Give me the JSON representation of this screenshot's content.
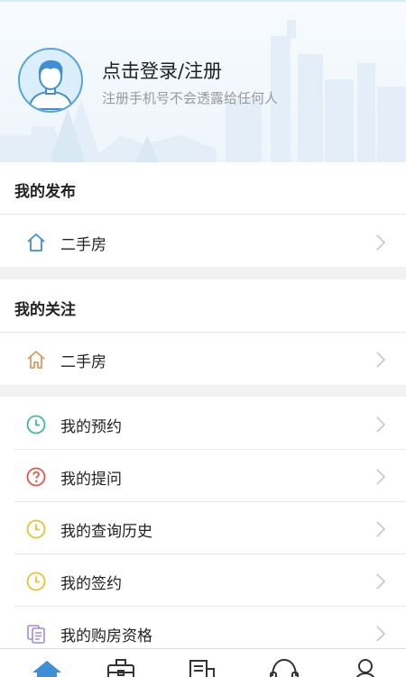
{
  "header": {
    "login_title": "点击登录/注册",
    "login_subtitle": "注册手机号不会透露给任何人",
    "avatar_icon": "user-avatar-icon"
  },
  "my_posts": {
    "title": "我的发布",
    "items": [
      {
        "label": "二手房",
        "icon": "house-outline-icon",
        "color": "#3d8fd6"
      }
    ]
  },
  "my_follows": {
    "title": "我的关注",
    "items": [
      {
        "label": "二手房",
        "icon": "house-outline-icon",
        "color": "#e19a5b"
      }
    ]
  },
  "menu": {
    "items": [
      {
        "label": "我的预约",
        "icon": "clock-icon",
        "color": "#3fbf8a"
      },
      {
        "label": "我的提问",
        "icon": "question-icon",
        "color": "#e5534b"
      },
      {
        "label": "我的查询历史",
        "icon": "clock-icon",
        "color": "#e8c234"
      },
      {
        "label": "我的签约",
        "icon": "clock-icon",
        "color": "#e8c234"
      },
      {
        "label": "我的购房资格",
        "icon": "document-icon",
        "color": "#a58ad8"
      }
    ]
  },
  "tabbar": {
    "active_color": "#3d8fd6",
    "inactive_color": "#333333",
    "tabs": [
      {
        "icon": "home-icon",
        "active": true
      },
      {
        "icon": "briefcase-icon",
        "active": false
      },
      {
        "icon": "news-icon",
        "active": false
      },
      {
        "icon": "headset-icon",
        "active": false
      },
      {
        "icon": "user-icon",
        "active": false
      }
    ]
  }
}
